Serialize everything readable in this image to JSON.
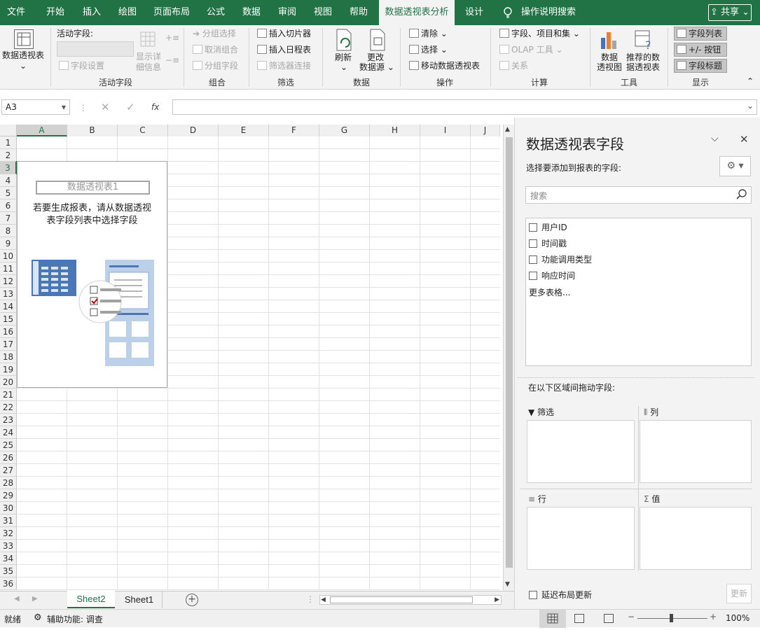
{
  "tabs": [
    "文件",
    "开始",
    "插入",
    "绘图",
    "页面布局",
    "公式",
    "数据",
    "审阅",
    "视图",
    "帮助",
    "数据透视表分析",
    "设计"
  ],
  "active_tab": "数据透视表分析",
  "tell_me": "操作说明搜索",
  "share": "共享",
  "ribbon": {
    "pivottable_btn": "数据透视表",
    "active_field_label": "活动字段:",
    "field_settings": "字段设置",
    "drill_down_1": "显示详",
    "drill_down_2": "细信息",
    "group_active": "活动字段",
    "group_selection": "分组选择",
    "ungroup": "取消组合",
    "group_field": "分组字段",
    "group_group": "组合",
    "insert_slicer": "插入切片器",
    "insert_timeline": "插入日程表",
    "filter_connections": "筛选器连接",
    "group_filter": "筛选",
    "refresh": "刷新",
    "change_source_1": "更改",
    "change_source_2": "数据源",
    "group_data": "数据",
    "clear": "清除",
    "select": "选择",
    "move_pivot": "移动数据透视表",
    "group_actions": "操作",
    "fields_items": "字段、项目和集",
    "olap_tools": "OLAP 工具",
    "relationships": "关系",
    "group_calc": "计算",
    "pivotchart_1": "数据",
    "pivotchart_2": "透视图",
    "recommended_1": "推荐的数",
    "recommended_2": "据透视表",
    "group_tools": "工具",
    "field_list": "字段列表",
    "plus_minus": "+/- 按钮",
    "field_headers": "字段标题",
    "group_show": "显示"
  },
  "formula_bar": {
    "name_box": "A3",
    "fx": "fx",
    "formula": ""
  },
  "columns": [
    "A",
    "B",
    "C",
    "D",
    "E",
    "F",
    "G",
    "H",
    "I",
    "J"
  ],
  "rows": [
    "1",
    "2",
    "3",
    "4",
    "5",
    "6",
    "7",
    "8",
    "9",
    "10",
    "11",
    "12",
    "13",
    "14",
    "15",
    "16",
    "17",
    "18",
    "19",
    "20",
    "21",
    "22",
    "23",
    "24",
    "25",
    "26",
    "27",
    "28",
    "29",
    "30",
    "31",
    "32",
    "33",
    "34",
    "35",
    "36"
  ],
  "pivot_placeholder": {
    "name": "数据透视表1",
    "hint_line1": "若要生成报表，请从数据透视",
    "hint_line2": "表字段列表中选择字段"
  },
  "sheets": [
    "Sheet2",
    "Sheet1"
  ],
  "active_sheet": "Sheet2",
  "status": {
    "ready": "就绪",
    "accessibility": "辅助功能: 调查",
    "zoom": "100%"
  },
  "pane": {
    "title": "数据透视表字段",
    "subtitle": "选择要添加到报表的字段:",
    "search_placeholder": "搜索",
    "fields": [
      "用户ID",
      "时间戳",
      "功能调用类型",
      "响应时间"
    ],
    "more_tables": "更多表格...",
    "drag_hint": "在以下区域间拖动字段:",
    "zone_filter": "筛选",
    "zone_columns": "列",
    "zone_rows": "行",
    "zone_values": "值",
    "defer_update": "延迟布局更新",
    "update_btn": "更新"
  },
  "colors": {
    "excel_green": "#217346",
    "ribbon_bg": "#f3f3f3",
    "selection_green": "#217346"
  }
}
